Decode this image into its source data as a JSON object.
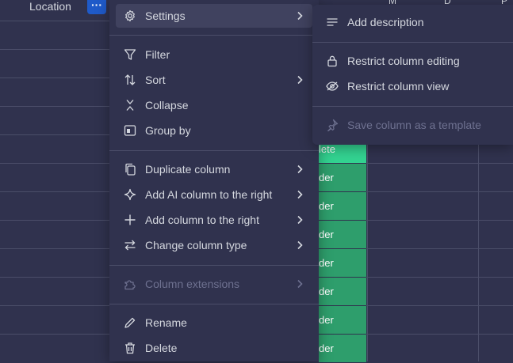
{
  "board": {
    "location_header": "Location",
    "more_button": "···",
    "partial_headers": [
      "M",
      "D",
      "P"
    ],
    "status_cells": [
      "lete",
      "der",
      "der",
      "der",
      "der",
      "der",
      "der",
      "der"
    ]
  },
  "menu": {
    "items": [
      {
        "label": "Settings",
        "icon": "gear-icon",
        "has_submenu": true,
        "active": true
      },
      {
        "label": "Filter",
        "icon": "filter-icon",
        "has_submenu": false
      },
      {
        "label": "Sort",
        "icon": "sort-icon",
        "has_submenu": true
      },
      {
        "label": "Collapse",
        "icon": "collapse-icon",
        "has_submenu": false
      },
      {
        "label": "Group by",
        "icon": "group-by-icon",
        "has_submenu": false
      },
      {
        "label": "Duplicate column",
        "icon": "duplicate-icon",
        "has_submenu": true
      },
      {
        "label": "Add AI column to the right",
        "icon": "ai-sparkle-icon",
        "has_submenu": true
      },
      {
        "label": "Add column to the right",
        "icon": "plus-icon",
        "has_submenu": true
      },
      {
        "label": "Change column type",
        "icon": "swap-icon",
        "has_submenu": true
      },
      {
        "label": "Column extensions",
        "icon": "puzzle-icon",
        "has_submenu": true,
        "disabled": true
      },
      {
        "label": "Rename",
        "icon": "pencil-icon",
        "has_submenu": false
      },
      {
        "label": "Delete",
        "icon": "trash-icon",
        "has_submenu": false
      }
    ]
  },
  "submenu": {
    "items": [
      {
        "label": "Add description",
        "icon": "description-icon"
      },
      {
        "label": "Restrict column editing",
        "icon": "lock-icon"
      },
      {
        "label": "Restrict column view",
        "icon": "eye-off-icon"
      },
      {
        "label": "Save column as a template",
        "icon": "pin-icon",
        "disabled": true
      }
    ]
  },
  "colors": {
    "background": "#30324e",
    "active_item": "#40425f",
    "status_green": "#2e9e6c",
    "status_light_green": "#33d391",
    "accent_blue": "#1f5ac9",
    "text": "#d5d8df",
    "disabled_text": "#6e7190"
  }
}
